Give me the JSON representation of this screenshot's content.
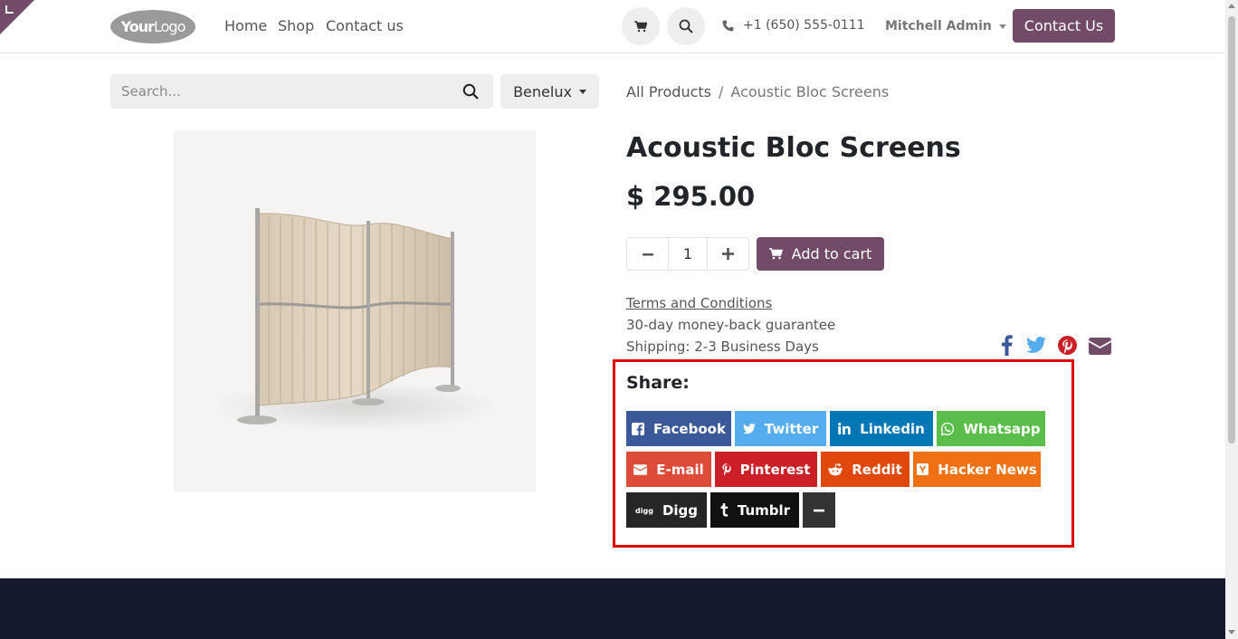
{
  "header": {
    "logo_text_bold": "Your",
    "logo_text_thin": "Logo",
    "nav_home": "Home",
    "nav_shop": "Shop",
    "nav_contact": "Contact us",
    "phone": "+1 (650) 555-0111",
    "user": "Mitchell Admin",
    "contact_button": "Contact Us"
  },
  "search": {
    "placeholder": "Search...",
    "pricelist": "Benelux"
  },
  "breadcrumb": {
    "all_products": "All Products",
    "separator": "/",
    "current": "Acoustic Bloc Screens"
  },
  "product": {
    "title": "Acoustic Bloc Screens",
    "price": "$ 295.00",
    "quantity": "1",
    "add_to_cart": "Add to cart",
    "terms": "Terms and Conditions",
    "guarantee": "30-day money-back guarantee",
    "shipping": "Shipping: 2-3 Business Days"
  },
  "share": {
    "title": "Share:",
    "buttons": [
      {
        "label": "Facebook",
        "color": "#3b5998"
      },
      {
        "label": "Twitter",
        "color": "#55acee"
      },
      {
        "label": "Linkedin",
        "color": "#0077b5"
      },
      {
        "label": "Whatsapp",
        "color": "#5cbe4a"
      },
      {
        "label": "E-mail",
        "color": "#dd4b39"
      },
      {
        "label": "Pinterest",
        "color": "#cb2027"
      },
      {
        "label": "Reddit",
        "color": "#e0480c"
      },
      {
        "label": "Hacker News",
        "color": "#f07113"
      },
      {
        "label": "Digg",
        "color": "#262626"
      },
      {
        "label": "Tumblr",
        "color": "#111111"
      },
      {
        "label": "",
        "color": "#333333"
      }
    ]
  },
  "colors": {
    "brand": "#714b67",
    "highlight": "#e00000",
    "footer": "#141a2e"
  }
}
